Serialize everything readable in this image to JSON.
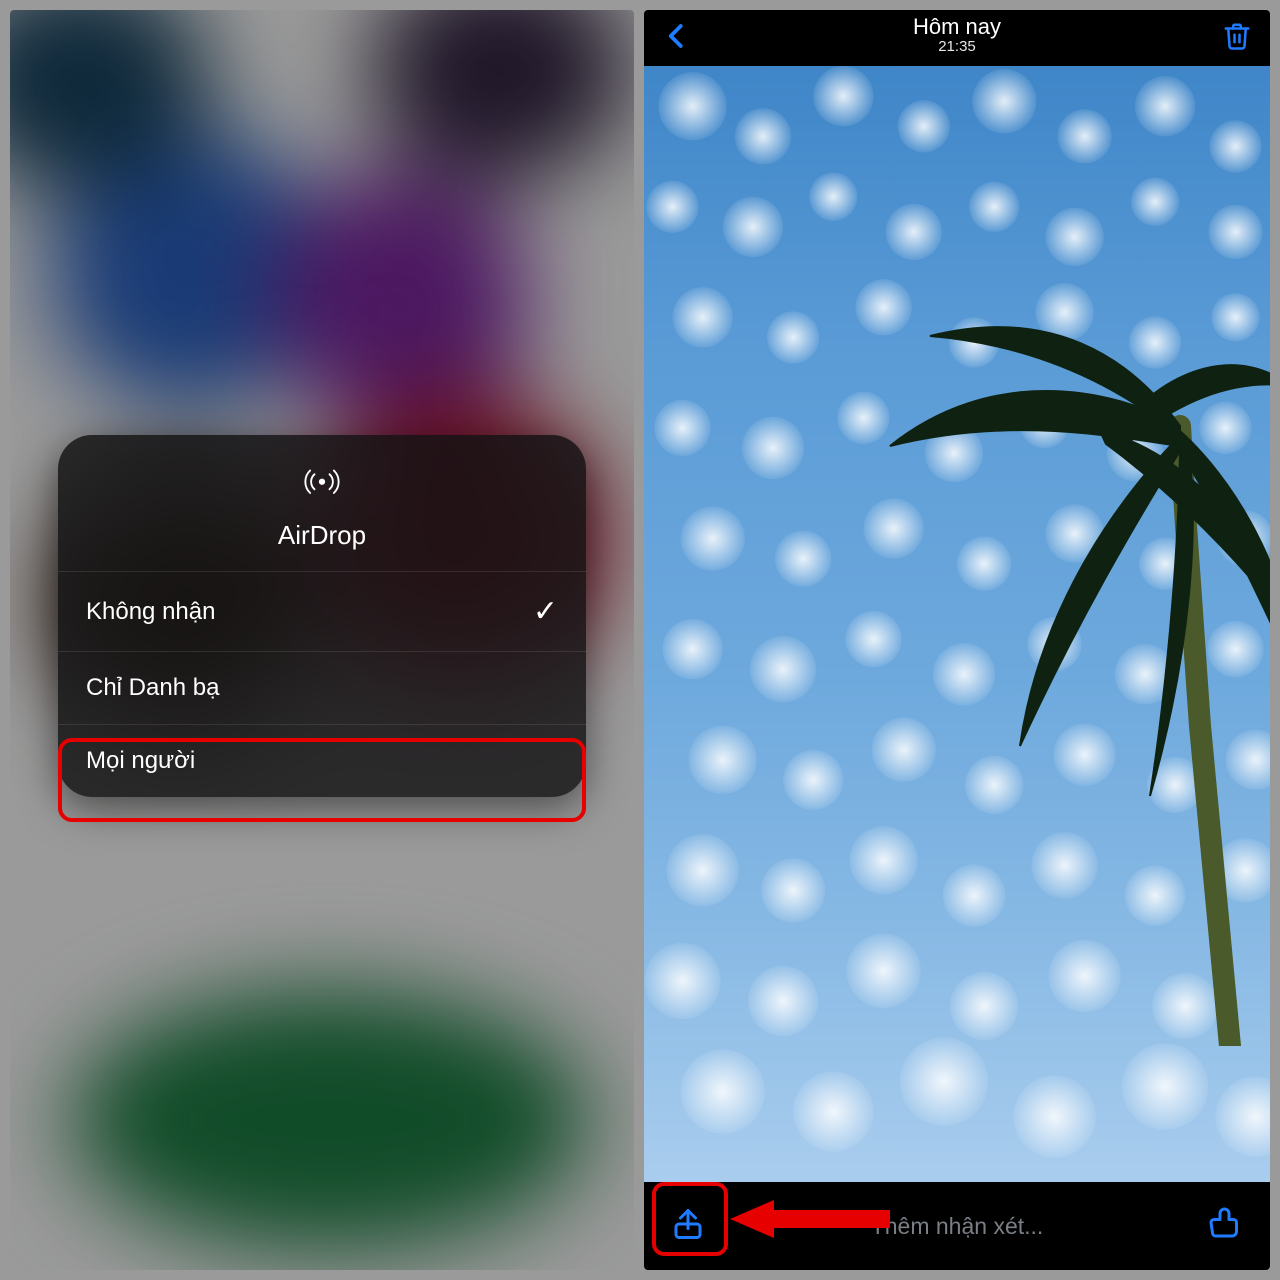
{
  "colors": {
    "ios_blue": "#1f7bff",
    "highlight_red": "#e60000"
  },
  "airdrop": {
    "title": "AirDrop",
    "icon": "airdrop-icon",
    "options": [
      {
        "label": "Không nhận",
        "selected": true
      },
      {
        "label": "Chỉ Danh bạ",
        "selected": false
      },
      {
        "label": "Mọi người",
        "selected": false
      }
    ],
    "highlighted_option_index": 2
  },
  "photo_viewer": {
    "header": {
      "title": "Hôm nay",
      "subtitle": "21:35"
    },
    "toolbar": {
      "back_icon": "chevron-left-icon",
      "delete_icon": "trash-icon",
      "share_icon": "share-icon",
      "like_icon": "thumbs-up-icon",
      "caption_placeholder": "Thêm nhận xét..."
    },
    "annotations": {
      "share_highlighted": true,
      "arrow_points_to": "share-icon"
    }
  }
}
